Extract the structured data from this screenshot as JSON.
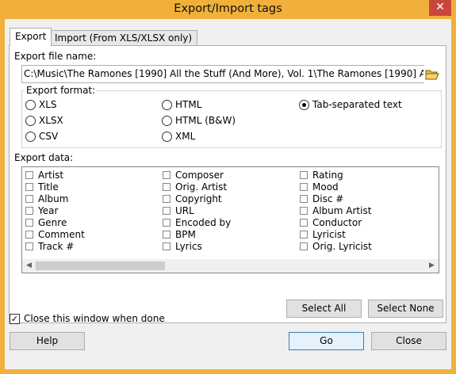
{
  "window": {
    "title": "Export/Import tags",
    "close_glyph": "✕"
  },
  "tabs": [
    {
      "label": "Export",
      "active": true
    },
    {
      "label": "Import (From XLS/XLSX only)",
      "active": false
    }
  ],
  "export": {
    "file_name_label": "Export file name:",
    "file_name_value": "C:\\Music\\The Ramones [1990] All the Stuff (And More), Vol. 1\\The Ramones [1990] All the Stuff (And More",
    "browse_icon": "folder-open-icon",
    "format_label": "Export format:",
    "formats": [
      {
        "label": "XLS",
        "selected": false
      },
      {
        "label": "XLSX",
        "selected": false
      },
      {
        "label": "CSV",
        "selected": false
      },
      {
        "label": "HTML",
        "selected": false
      },
      {
        "label": "HTML (B&W)",
        "selected": false
      },
      {
        "label": "XML",
        "selected": false
      },
      {
        "label": "Tab-separated text",
        "selected": true
      }
    ],
    "data_label": "Export data:",
    "fields": [
      {
        "label": "Artist",
        "checked": false
      },
      {
        "label": "Title",
        "checked": false
      },
      {
        "label": "Album",
        "checked": false
      },
      {
        "label": "Year",
        "checked": false
      },
      {
        "label": "Genre",
        "checked": false
      },
      {
        "label": "Comment",
        "checked": false
      },
      {
        "label": "Track #",
        "checked": false
      },
      {
        "label": "Composer",
        "checked": false
      },
      {
        "label": "Orig. Artist",
        "checked": false
      },
      {
        "label": "Copyright",
        "checked": false
      },
      {
        "label": "URL",
        "checked": false
      },
      {
        "label": "Encoded by",
        "checked": false
      },
      {
        "label": "BPM",
        "checked": false
      },
      {
        "label": "Lyrics",
        "checked": false
      },
      {
        "label": "Rating",
        "checked": false
      },
      {
        "label": "Mood",
        "checked": false
      },
      {
        "label": "Disc #",
        "checked": false
      },
      {
        "label": "Album Artist",
        "checked": false
      },
      {
        "label": "Conductor",
        "checked": false
      },
      {
        "label": "Lyricist",
        "checked": false
      },
      {
        "label": "Orig. Lyricist",
        "checked": false
      }
    ],
    "select_all": "Select All",
    "select_none": "Select None"
  },
  "close_when_done": {
    "label": "Close this window when done",
    "checked": true
  },
  "buttons": {
    "help": "Help",
    "go": "Go",
    "close": "Close"
  },
  "colors": {
    "titlebar": "#f0b03a",
    "close_button": "#c7483b"
  }
}
